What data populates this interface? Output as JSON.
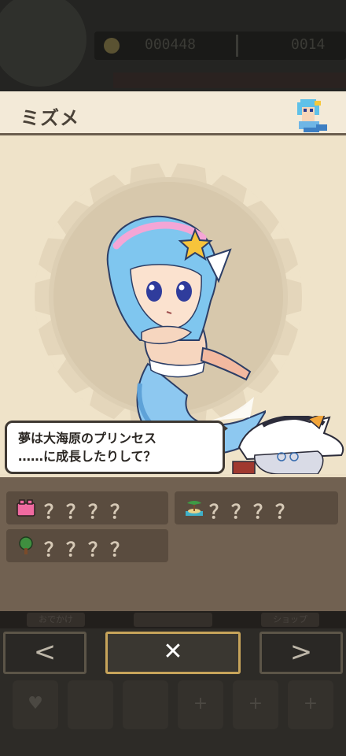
{
  "background": {
    "coin_count": "000448",
    "gem_count": "0014",
    "tab_labels": [
      "おでかけ",
      "",
      "ショップ"
    ]
  },
  "card": {
    "title": "ミズメ",
    "speech": [
      "夢は大海原のプリンセス",
      "……に成長したりして？"
    ],
    "requirements": [
      {
        "icon": "pink-block-icon",
        "text": "？？？？"
      },
      {
        "icon": "island-icon",
        "text": "？？？？"
      },
      {
        "icon": "tree-icon",
        "text": "？？？？"
      }
    ]
  },
  "nav": {
    "prev_label": "<",
    "close_label": "✕",
    "next_label": ">"
  },
  "colors": {
    "panel_bg": "#ecdfc5",
    "info_bg": "#716151",
    "accent_gold": "#c7a45a",
    "text_dark": "#4a4238"
  }
}
